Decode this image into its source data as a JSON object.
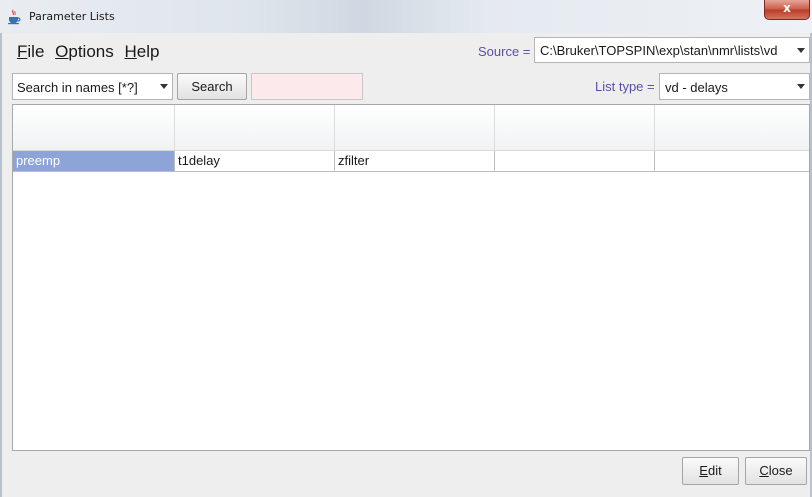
{
  "window": {
    "title": "Parameter Lists",
    "close_glyph": "x",
    "icon": "java-cup-icon"
  },
  "menu": [
    {
      "mnemonic": "F",
      "rest": "ile"
    },
    {
      "mnemonic": "O",
      "rest": "ptions"
    },
    {
      "mnemonic": "H",
      "rest": "elp"
    }
  ],
  "source": {
    "label": "Source =",
    "value": "C:\\Bruker\\TOPSPIN\\exp\\stan\\nmr\\lists\\vd"
  },
  "search": {
    "mode_value": "Search in names [*?]",
    "button_label": "Search",
    "input_value": ""
  },
  "list_type": {
    "label": "List type =",
    "value": "vd - delays"
  },
  "table": {
    "rows": [
      [
        "preemp",
        "t1delay",
        "zfilter",
        "",
        ""
      ]
    ],
    "selected": [
      0,
      0
    ]
  },
  "buttons": {
    "edit": {
      "mnemonic": "E",
      "rest": "dit"
    },
    "close": {
      "mnemonic": "C",
      "rest": "lose"
    }
  },
  "colors": {
    "label_accent": "#5a4fa8",
    "selection": "#8ea3d8",
    "search_field_bg": "#fbe9ec"
  }
}
